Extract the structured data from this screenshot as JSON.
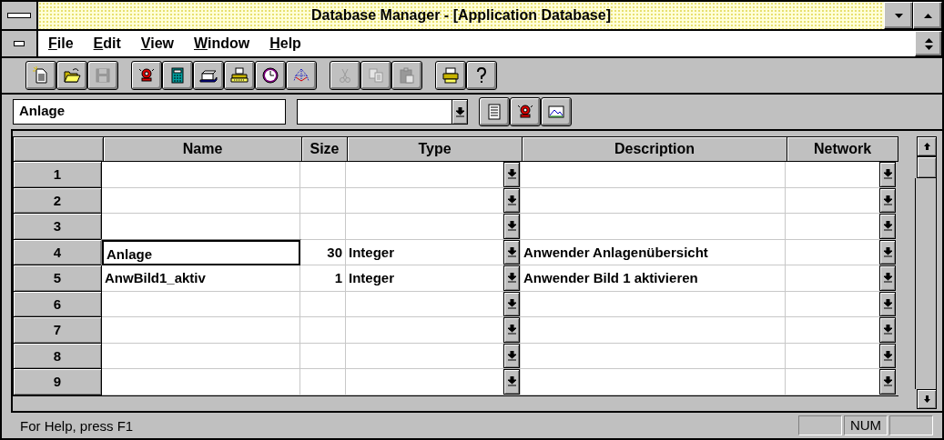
{
  "window": {
    "title": "Database Manager - [Application Database]"
  },
  "menu": [
    {
      "label": "File"
    },
    {
      "label": "Edit"
    },
    {
      "label": "View"
    },
    {
      "label": "Window"
    },
    {
      "label": "Help"
    }
  ],
  "toolbar": [
    [
      {
        "kind": "new",
        "disabled": false
      },
      {
        "kind": "open",
        "disabled": false
      },
      {
        "kind": "save",
        "disabled": true
      }
    ],
    [
      {
        "kind": "alarm",
        "disabled": false
      },
      {
        "kind": "calculator",
        "disabled": false
      },
      {
        "kind": "cards",
        "disabled": false
      },
      {
        "kind": "typewriter",
        "disabled": false
      },
      {
        "kind": "clock",
        "disabled": false
      },
      {
        "kind": "network",
        "disabled": false
      }
    ],
    [
      {
        "kind": "cut",
        "disabled": true
      },
      {
        "kind": "copy",
        "disabled": true
      },
      {
        "kind": "paste",
        "disabled": true
      }
    ],
    [
      {
        "kind": "print",
        "disabled": false
      },
      {
        "kind": "help",
        "disabled": false
      }
    ]
  ],
  "filter_bar": {
    "name_field": {
      "value": "Anlage"
    },
    "buttons": [
      {
        "kind": "form",
        "disabled": false
      },
      {
        "kind": "alarm",
        "disabled": false
      },
      {
        "kind": "picture",
        "disabled": false
      }
    ]
  },
  "table": {
    "columns": [
      "Name",
      "Size",
      "Type",
      "Description",
      "Network"
    ],
    "rows": [
      {
        "number": "1",
        "selected": false
      },
      {
        "number": "2",
        "selected": false
      },
      {
        "number": "3",
        "selected": false
      },
      {
        "number": "4",
        "name": "Anlage",
        "size": "30",
        "type": "Integer",
        "description": "Anwender Anlagenübersicht",
        "selected": true
      },
      {
        "number": "5",
        "name": "AnwBild1_aktiv",
        "size": "1",
        "type": "Integer",
        "description": "Anwender Bild 1 aktivieren",
        "selected": false
      },
      {
        "number": "6",
        "selected": false
      },
      {
        "number": "7",
        "selected": false
      },
      {
        "number": "8",
        "selected": false
      },
      {
        "number": "9",
        "selected": false
      }
    ]
  },
  "status_bar": {
    "text": "For Help, press F1",
    "indicator": "NUM"
  }
}
